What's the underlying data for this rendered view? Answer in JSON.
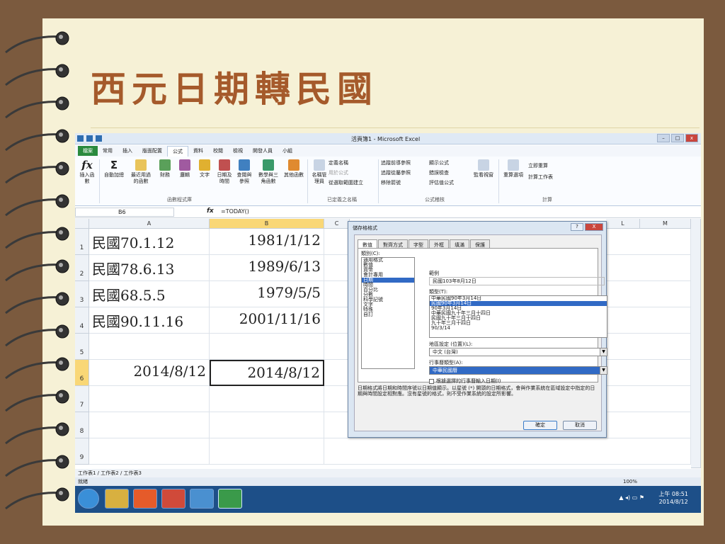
{
  "slide": {
    "title": "西元日期轉民國"
  },
  "excel": {
    "window_title": "活頁簿1 - Microsoft Excel",
    "tabs": [
      "檔案",
      "常用",
      "插入",
      "版面配置",
      "公式",
      "資料",
      "校閱",
      "檢視",
      "開發人員",
      "小組"
    ],
    "active_tab": "公式",
    "ribbon": {
      "buttons": [
        {
          "label": "插入函數"
        },
        {
          "label": "自動加總"
        },
        {
          "label": "最近用過的函數"
        },
        {
          "label": "財務"
        },
        {
          "label": "邏輯"
        },
        {
          "label": "文字"
        },
        {
          "label": "日期及時間"
        },
        {
          "label": "查閱與參照"
        },
        {
          "label": "數學與三角函數"
        },
        {
          "label": "其他函數"
        },
        {
          "label": "名稱管理員"
        }
      ],
      "small": [
        "定義名稱",
        "用於公式",
        "從選取範圍建立",
        "追蹤前導參照",
        "追蹤從屬參照",
        "移除箭號",
        "顯示公式",
        "錯誤檢查",
        "評估值公式",
        "監看視窗",
        "重算選項",
        "立即重算",
        "計算工作表"
      ],
      "groups": [
        "函數程式庫",
        "已定義之名稱",
        "公式稽核",
        "計算"
      ]
    },
    "namebox": "B6",
    "fx_label": "fx",
    "formula": "=TODAY()",
    "columns": [
      "A",
      "B",
      "C",
      "L",
      "M"
    ],
    "rows": [
      {
        "num": "1",
        "a": "民國70.1.12",
        "b": "1981/1/12"
      },
      {
        "num": "2",
        "a": "民國78.6.13",
        "b": "1989/6/13"
      },
      {
        "num": "3",
        "a": "民國68.5.5",
        "b": "1979/5/5"
      },
      {
        "num": "4",
        "a": "民國90.11.16",
        "b": "2001/11/16"
      },
      {
        "num": "5",
        "a": "",
        "b": ""
      },
      {
        "num": "6",
        "a": "2014/8/12",
        "b": "2014/8/12"
      },
      {
        "num": "7",
        "a": "",
        "b": ""
      },
      {
        "num": "8",
        "a": "",
        "b": ""
      },
      {
        "num": "9",
        "a": "",
        "b": ""
      }
    ],
    "sheet_tabs": "工作表1 / 工作表2 / 工作表3",
    "status": "就緒",
    "zoom": "100%",
    "clock_time": "上午 08:51",
    "clock_date": "2014/8/12"
  },
  "dialog": {
    "title": "儲存格格式",
    "help": "?",
    "close": "X",
    "tabs": [
      "數值",
      "對齊方式",
      "字型",
      "外框",
      "填滿",
      "保護"
    ],
    "category_label": "類別(C):",
    "categories": [
      "通用格式",
      "數值",
      "貨幣",
      "會計專用",
      "日期",
      "時間",
      "百分比",
      "分數",
      "科學記號",
      "文字",
      "特殊",
      "自訂"
    ],
    "category_selected": "日期",
    "sample_label": "範例",
    "sample": "民國103年8月12日",
    "type_label": "類型(T):",
    "types": [
      "中華民國90年3月14日",
      "民國90年3月14日",
      "90年3月14日",
      "中華民國九十年三月十四日",
      "民國九十年三月十四日",
      "九十年三月十四日",
      "90/3/14"
    ],
    "type_selected": "民國90年3月14日",
    "locale_label": "地區設定 (位置)(L):",
    "locale": "中文 (台灣)",
    "calendar_label": "行事曆類型(A):",
    "calendar": "中華民國曆",
    "checkbox": "根據選擇的行事曆輸入日期(I)",
    "description": "日期格式將日期和時間序號以日期值顯示。以星號 (*) 開頭的日期格式，會與作業系統在區域設定中指定的日期與時間設定相對應。沒有星號的格式，則不受作業系統的設定所影響。",
    "ok": "確定",
    "cancel": "取消"
  }
}
